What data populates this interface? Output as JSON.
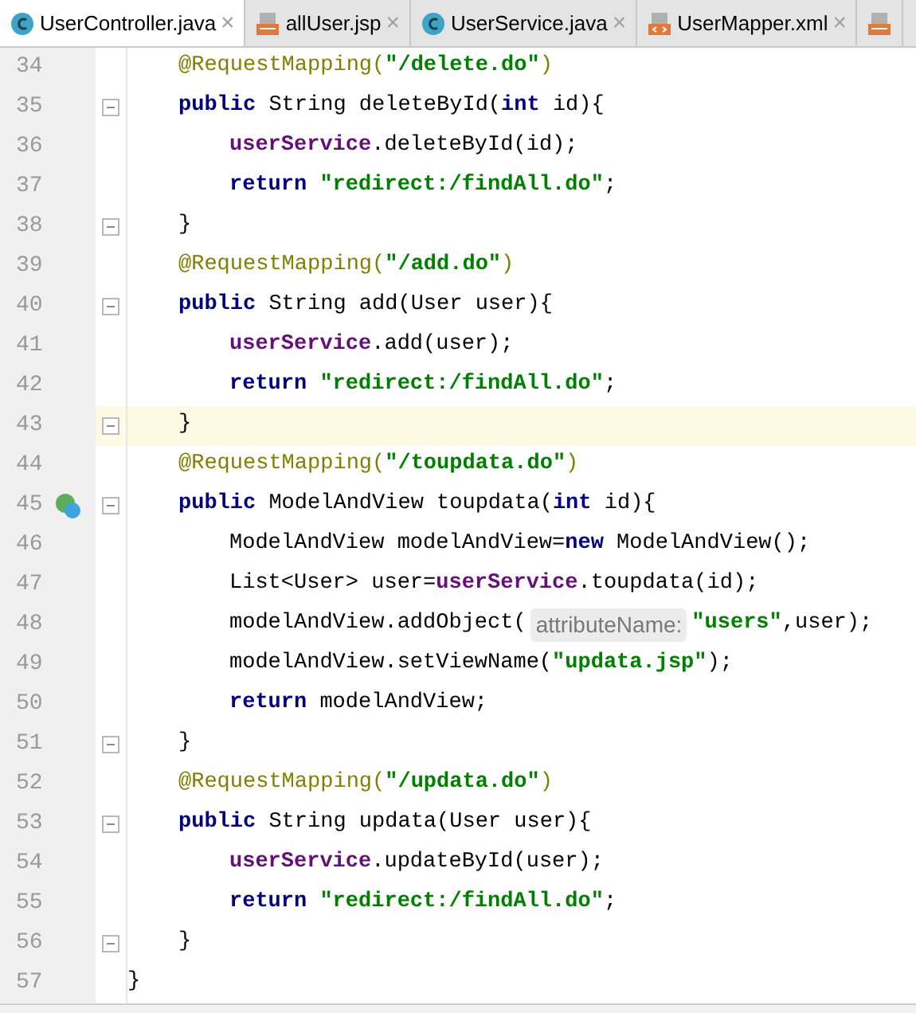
{
  "tabs": [
    {
      "label": "UserController.java",
      "kind": "class",
      "selected": true
    },
    {
      "label": "allUser.jsp",
      "kind": "jsp",
      "selected": false
    },
    {
      "label": "UserService.java",
      "kind": "class",
      "selected": false
    },
    {
      "label": "UserMapper.xml",
      "kind": "xml",
      "selected": false
    },
    {
      "kind": "jsp",
      "selected": false
    }
  ],
  "tab_close": "×",
  "body": [
    {
      "number": "34",
      "fold": false,
      "current": false,
      "tokens": [
        {
          "kind": "ann",
          "text": "@RequestMapping("
        },
        {
          "kind": "str",
          "text": "\"/delete.do\""
        },
        {
          "kind": "ann",
          "text": ")"
        }
      ]
    },
    {
      "number": "35",
      "fold": true,
      "current": false,
      "tokens": [
        {
          "kind": "kw",
          "text": "public"
        },
        {
          "kind": "plain",
          "text": " String deleteById("
        },
        {
          "kind": "kw",
          "text": "int"
        },
        {
          "kind": "plain",
          "text": " id){"
        }
      ],
      "children": [
        {
          "number": "36",
          "fold": false,
          "current": false,
          "tokens": [
            {
              "kind": "field",
              "text": "userService"
            },
            {
              "kind": "plain",
              "text": ".deleteById(id);"
            }
          ]
        },
        {
          "number": "37",
          "fold": false,
          "current": false,
          "tokens": [
            {
              "kind": "kw",
              "text": "return"
            },
            {
              "kind": "str",
              "text": " \"redirect:/findAll.do\""
            },
            {
              "kind": "plain",
              "text": ";"
            }
          ]
        }
      ]
    },
    {
      "number": "38",
      "fold": true,
      "current": false,
      "tokens": [
        {
          "kind": "plain",
          "text": "}"
        }
      ]
    },
    {
      "number": "39",
      "fold": false,
      "current": false,
      "tokens": [
        {
          "kind": "ann",
          "text": "@RequestMapping("
        },
        {
          "kind": "str",
          "text": "\"/add.do\""
        },
        {
          "kind": "ann",
          "text": ")"
        }
      ]
    },
    {
      "number": "40",
      "fold": true,
      "current": false,
      "tokens": [
        {
          "kind": "kw",
          "text": "public"
        },
        {
          "kind": "plain",
          "text": " String add(User user){"
        }
      ],
      "children": [
        {
          "number": "41",
          "fold": false,
          "current": false,
          "tokens": [
            {
              "kind": "field",
              "text": "userService"
            },
            {
              "kind": "plain",
              "text": ".add(user);"
            }
          ]
        },
        {
          "number": "42",
          "fold": false,
          "current": false,
          "tokens": [
            {
              "kind": "kw",
              "text": "return"
            },
            {
              "kind": "str",
              "text": " \"redirect:/findAll.do\""
            },
            {
              "kind": "plain",
              "text": ";"
            }
          ]
        }
      ]
    },
    {
      "number": "43",
      "fold": true,
      "current": true,
      "tokens": [
        {
          "kind": "plain",
          "text": "}"
        }
      ]
    },
    {
      "number": "44",
      "fold": false,
      "current": false,
      "tokens": [
        {
          "kind": "ann",
          "text": "@RequestMapping("
        },
        {
          "kind": "str",
          "text": "\"/toupdata.do\""
        },
        {
          "kind": "ann",
          "text": ")"
        }
      ]
    },
    {
      "number": "45",
      "fold": true,
      "current": false,
      "bean_marker": true,
      "tokens": [
        {
          "kind": "kw",
          "text": "public"
        },
        {
          "kind": "plain",
          "text": " ModelAndView toupdata("
        },
        {
          "kind": "kw",
          "text": "int"
        },
        {
          "kind": "plain",
          "text": " id){"
        }
      ],
      "children": [
        {
          "number": "46",
          "fold": false,
          "current": false,
          "tokens": [
            {
              "kind": "plain",
              "text": "ModelAndView modelAndView="
            },
            {
              "kind": "kw",
              "text": "new"
            },
            {
              "kind": "plain",
              "text": " ModelAndView();"
            }
          ]
        },
        {
          "number": "47",
          "fold": false,
          "current": false,
          "tokens": [
            {
              "kind": "plain",
              "text": "List<User> user="
            },
            {
              "kind": "field",
              "text": "userService"
            },
            {
              "kind": "plain",
              "text": ".toupdata(id);"
            }
          ]
        },
        {
          "number": "48",
          "fold": false,
          "current": false,
          "tokens": [
            {
              "kind": "plain",
              "text": "modelAndView.addObject("
            },
            {
              "kind": "hint",
              "text": "attributeName:"
            },
            {
              "kind": "str",
              "text": "\"users\""
            },
            {
              "kind": "plain",
              "text": ",user);"
            }
          ]
        },
        {
          "number": "49",
          "fold": false,
          "current": false,
          "tokens": [
            {
              "kind": "plain",
              "text": "modelAndView.setViewName("
            },
            {
              "kind": "str",
              "text": "\"updata.jsp\""
            },
            {
              "kind": "plain",
              "text": ");"
            }
          ]
        },
        {
          "number": "50",
          "fold": false,
          "current": false,
          "tokens": [
            {
              "kind": "kw",
              "text": "return"
            },
            {
              "kind": "plain",
              "text": " modelAndView;"
            }
          ]
        }
      ]
    },
    {
      "number": "51",
      "fold": true,
      "current": false,
      "tokens": [
        {
          "kind": "plain",
          "text": "}"
        }
      ]
    },
    {
      "number": "52",
      "fold": false,
      "current": false,
      "tokens": [
        {
          "kind": "ann",
          "text": "@RequestMapping("
        },
        {
          "kind": "str",
          "text": "\"/updata.do\""
        },
        {
          "kind": "ann",
          "text": ")"
        }
      ]
    },
    {
      "number": "53",
      "fold": true,
      "current": false,
      "tokens": [
        {
          "kind": "kw",
          "text": "public"
        },
        {
          "kind": "plain",
          "text": " String updata(User user){"
        }
      ],
      "children": [
        {
          "number": "54",
          "fold": false,
          "current": false,
          "tokens": [
            {
              "kind": "field",
              "text": "userService"
            },
            {
              "kind": "plain",
              "text": ".updateById(user);"
            }
          ]
        },
        {
          "number": "55",
          "fold": false,
          "current": false,
          "tokens": [
            {
              "kind": "kw",
              "text": "return"
            },
            {
              "kind": "str",
              "text": " \"redirect:/findAll.do\""
            },
            {
              "kind": "plain",
              "text": ";"
            }
          ]
        }
      ]
    },
    {
      "number": "56",
      "fold": true,
      "current": false,
      "tokens": [
        {
          "kind": "plain",
          "text": "}"
        }
      ]
    }
  ],
  "closing_line": {
    "number": "57",
    "fold": false,
    "current": false,
    "tokens": [
      {
        "kind": "plain",
        "text": "}"
      }
    ]
  }
}
